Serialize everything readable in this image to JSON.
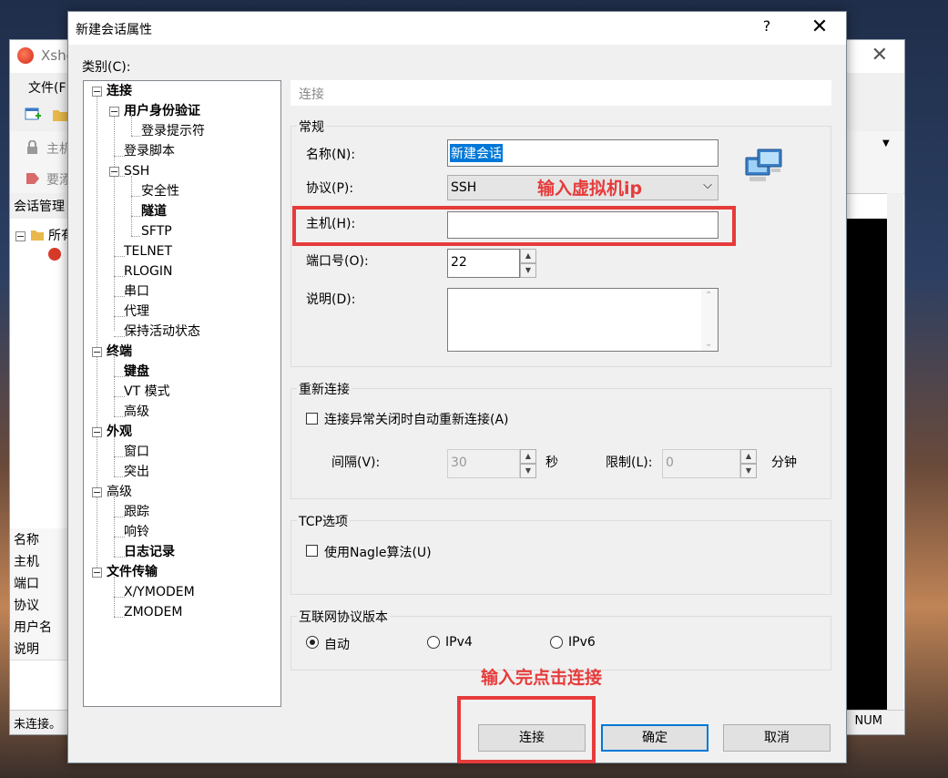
{
  "background_window": {
    "title": "Xshe",
    "menu_file": "文件(F",
    "host_prefix": "主机",
    "token_prefix": "要添",
    "session_manager": "会话管理",
    "tree_all": "所有",
    "properties": [
      "名称",
      "主机",
      "端口",
      "协议",
      "用户名",
      "说明"
    ],
    "status_left": "未连接。",
    "status_right": "NUM"
  },
  "dialog": {
    "title": "新建会话属性",
    "help_icon": "?",
    "close_icon": "✕",
    "category_label": "类别(C):",
    "tree": [
      "连接",
      "用户身份验证",
      "登录提示符",
      "登录脚本",
      "SSH",
      "安全性",
      "隧道",
      "SFTP",
      "TELNET",
      "RLOGIN",
      "串口",
      "代理",
      "保持活动状态",
      "终端",
      "键盘",
      "VT 模式",
      "高级",
      "外观",
      "窗口",
      "突出",
      "高级",
      "跟踪",
      "响铃",
      "日志记录",
      "文件传输",
      "X/YMODEM",
      "ZMODEM"
    ],
    "page_header": "连接",
    "general": {
      "title": "常规",
      "name_label": "名称(N):",
      "name_value": "新建会话",
      "protocol_label": "协议(P):",
      "protocol_value": "SSH",
      "host_label": "主机(H):",
      "host_value": "",
      "port_label": "端口号(O):",
      "port_value": "22",
      "desc_label": "说明(D):",
      "desc_value": ""
    },
    "reconnect": {
      "title": "重新连接",
      "auto_label": "连接异常关闭时自动重新连接(A)",
      "auto_checked": false,
      "interval_label": "间隔(V):",
      "interval_value": "30",
      "interval_unit": "秒",
      "limit_label": "限制(L):",
      "limit_value": "0",
      "limit_unit": "分钟"
    },
    "tcp": {
      "title": "TCP选项",
      "nagle_label": "使用Nagle算法(U)",
      "nagle_checked": false
    },
    "ip_version": {
      "title": "互联网协议版本",
      "options": [
        "自动",
        "IPv4",
        "IPv6"
      ],
      "selected": "自动"
    },
    "buttons": {
      "connect": "连接",
      "ok": "确定",
      "cancel": "取消"
    }
  },
  "annotations": {
    "host_hint": "输入虚拟机ip",
    "connect_hint": "输入完点击连接",
    "color": "#e63b3b"
  }
}
